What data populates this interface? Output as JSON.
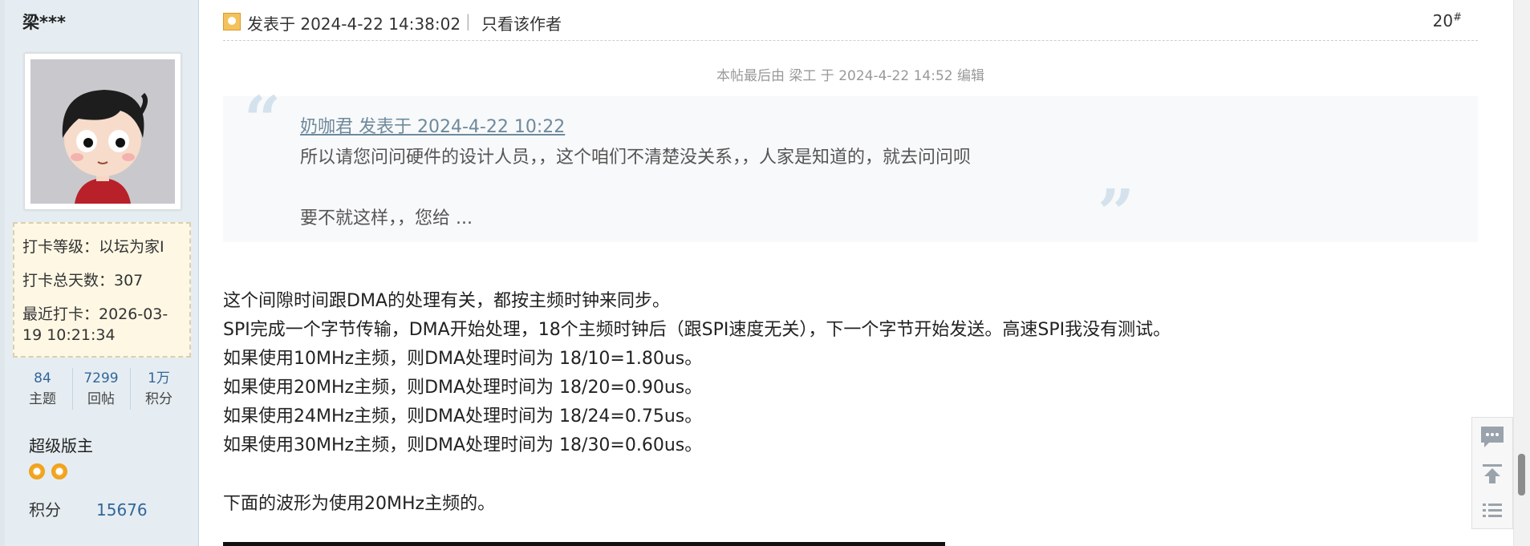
{
  "user": {
    "name": "梁***",
    "checkin_level": "打卡等级：以坛为家I",
    "checkin_days": "打卡总天数：307",
    "last_checkin_1": "最近打卡：2026-03-",
    "last_checkin_2": "19 10:21:34",
    "counters": [
      {
        "value": "84",
        "label": "主题"
      },
      {
        "value": "7299",
        "label": "回帖"
      },
      {
        "value": "1万",
        "label": "积分"
      }
    ],
    "rank": "超级版主",
    "points_label": "积分",
    "points_value": "15676"
  },
  "post": {
    "posted_at": "发表于 2024-4-22 14:38:02",
    "separator": "|",
    "only_author": "只看该作者",
    "floor": "20",
    "floor_mark": "#",
    "edit_note": "本帖最后由 梁工 于 2024-4-22 14:52 编辑",
    "quote": {
      "header": "奶咖君   发表于 2024-4-22 10:22",
      "line1": "所以请您问问硬件的设计人员，，这个咱们不清楚没关系，，人家是知道的，就去问问呗",
      "line2": "要不就这样，，您给 ...",
      "open_mark": "“",
      "close_mark": "”"
    },
    "lines": [
      "这个间隙时间跟DMA的处理有关，都按主频时钟来同步。",
      "SPI完成一个字节传输，DMA开始处理，18个主频时钟后（跟SPI速度无关），下一个字节开始发送。高速SPI我没有测试。",
      "如果使用10MHz主频，则DMA处理时间为 18/10=1.80us。",
      "如果使用20MHz主频，则DMA处理时间为 18/20=0.90us。",
      "如果使用24MHz主频，则DMA处理时间为 18/24=0.75us。",
      "如果使用30MHz主频，则DMA处理时间为 18/30=0.60us。",
      "下面的波形为使用20MHz主频的。"
    ]
  },
  "icons": {
    "author": "user-icon",
    "reply": "comment-icon",
    "top": "back-to-top-icon",
    "list": "list-icon"
  }
}
